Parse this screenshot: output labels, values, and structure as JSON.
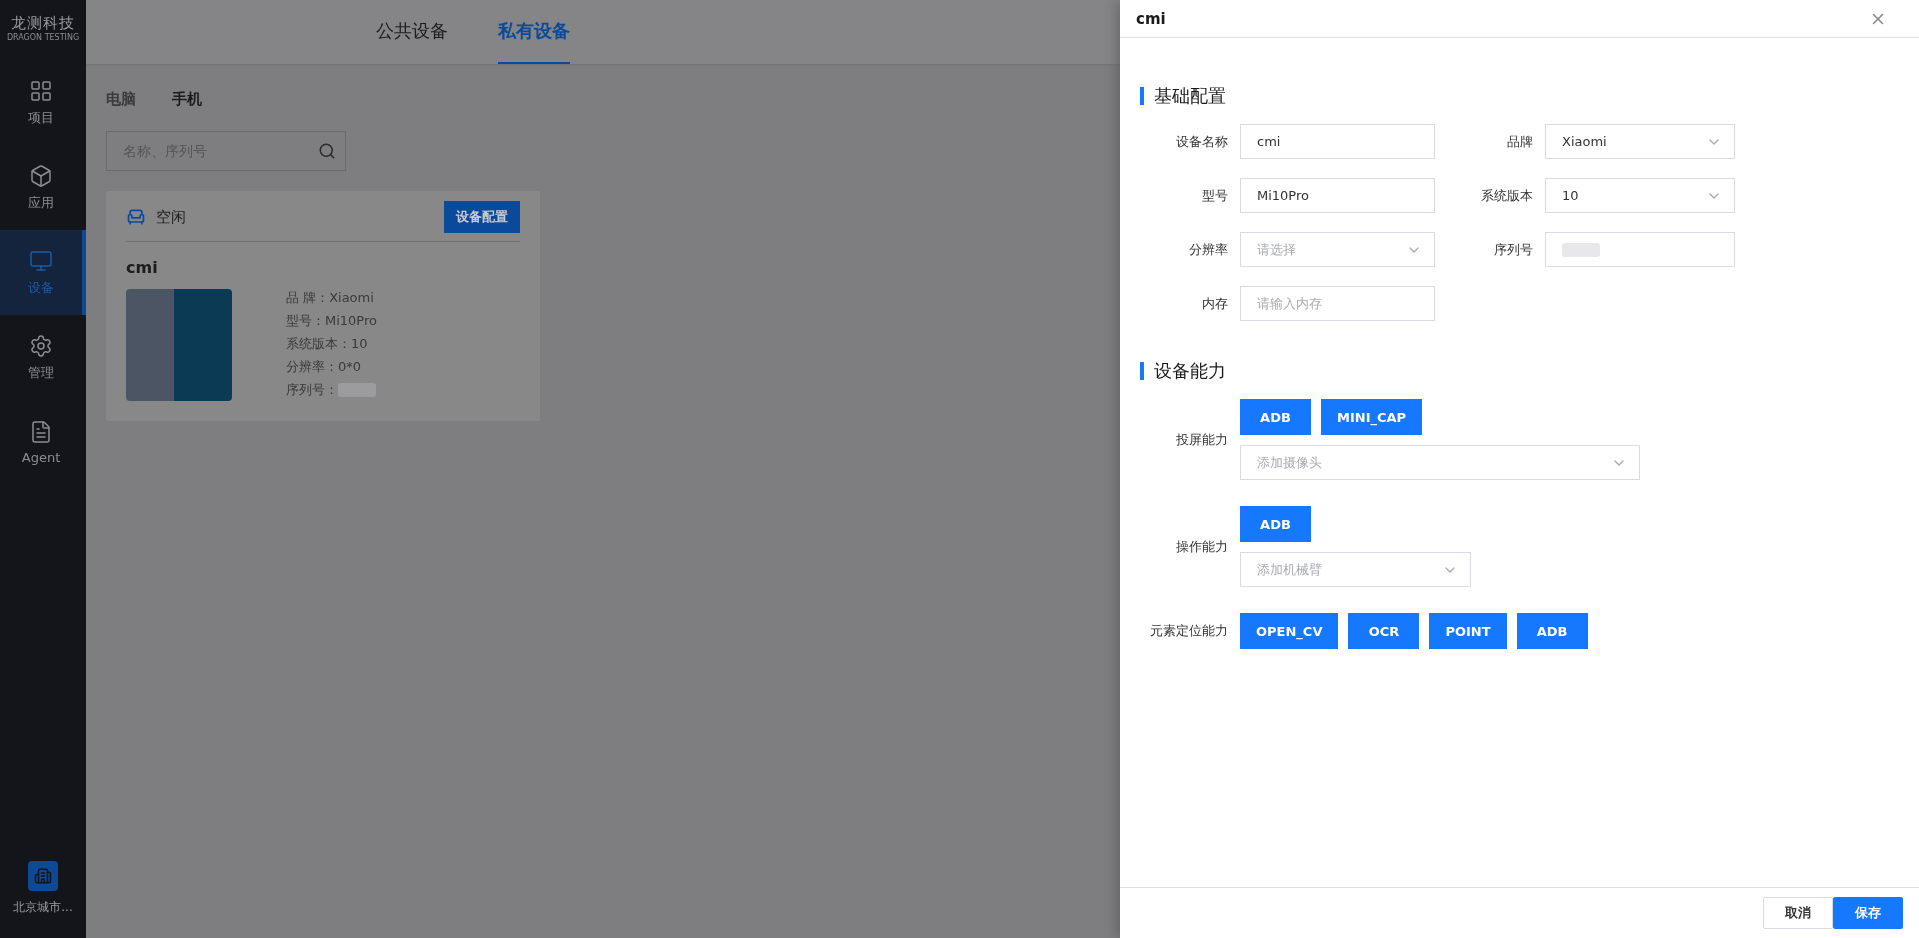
{
  "sidebar": {
    "logo": {
      "title": "龙测科技",
      "subtitle": "DRAGON TESTING"
    },
    "items": [
      {
        "label": "项目",
        "selected": false,
        "kind": "grid"
      },
      {
        "label": "应用",
        "selected": false,
        "kind": "box"
      },
      {
        "label": "设备",
        "selected": true,
        "kind": "monitor"
      },
      {
        "label": "管理",
        "selected": false,
        "kind": "gear"
      },
      {
        "label": "Agent",
        "selected": false,
        "kind": "doc"
      }
    ],
    "organization": "北京城市..."
  },
  "header_tabs": [
    {
      "label": "公共设备",
      "selected": false
    },
    {
      "label": "私有设备",
      "selected": true
    }
  ],
  "device_tabs": [
    {
      "label": "电脑",
      "selected": false
    },
    {
      "label": "手机",
      "selected": true
    }
  ],
  "search": {
    "placeholder": "名称、序列号"
  },
  "device_card": {
    "status": "空闲",
    "config_button": "设备配置",
    "name": "cmi",
    "specs": [
      {
        "label": "品 牌：",
        "value": "Xiaomi"
      },
      {
        "label": "型号：",
        "value": "Mi10Pro"
      },
      {
        "label": "系统版本：",
        "value": "10"
      },
      {
        "label": "分辨率：",
        "value": "0*0"
      },
      {
        "label": "序列号：",
        "redacted": true
      }
    ]
  },
  "drawer": {
    "title": "cmi",
    "basic_section": {
      "title": "基础配置",
      "fields": [
        {
          "label": "设备名称",
          "kind": "input",
          "value": "cmi"
        },
        {
          "label": "品牌",
          "kind": "select",
          "value": "Xiaomi"
        },
        {
          "label": "型号",
          "kind": "input",
          "value": "Mi10Pro"
        },
        {
          "label": "系统版本",
          "kind": "select",
          "value": "10"
        },
        {
          "label": "分辨率",
          "kind": "select",
          "placeholder": "请选择"
        },
        {
          "label": "序列号",
          "kind": "input",
          "redacted": true
        },
        {
          "label": "内存",
          "kind": "input",
          "placeholder": "请输入内存"
        }
      ]
    },
    "capability_section": {
      "title": "设备能力",
      "groups": [
        {
          "label": "投屏能力",
          "tags": [
            "ADB",
            "MINI_CAP"
          ],
          "select_placeholder": "添加摄像头"
        },
        {
          "label": "操作能力",
          "tags": [
            "ADB"
          ],
          "select_placeholder": "添加机械臂"
        },
        {
          "label": "元素定位能力",
          "tags": [
            "OPEN_CV",
            "OCR",
            "POINT",
            "ADB"
          ]
        }
      ]
    },
    "buttons": [
      {
        "label": "取消",
        "kind": "secondary"
      },
      {
        "label": "保存",
        "kind": "primary"
      }
    ]
  }
}
